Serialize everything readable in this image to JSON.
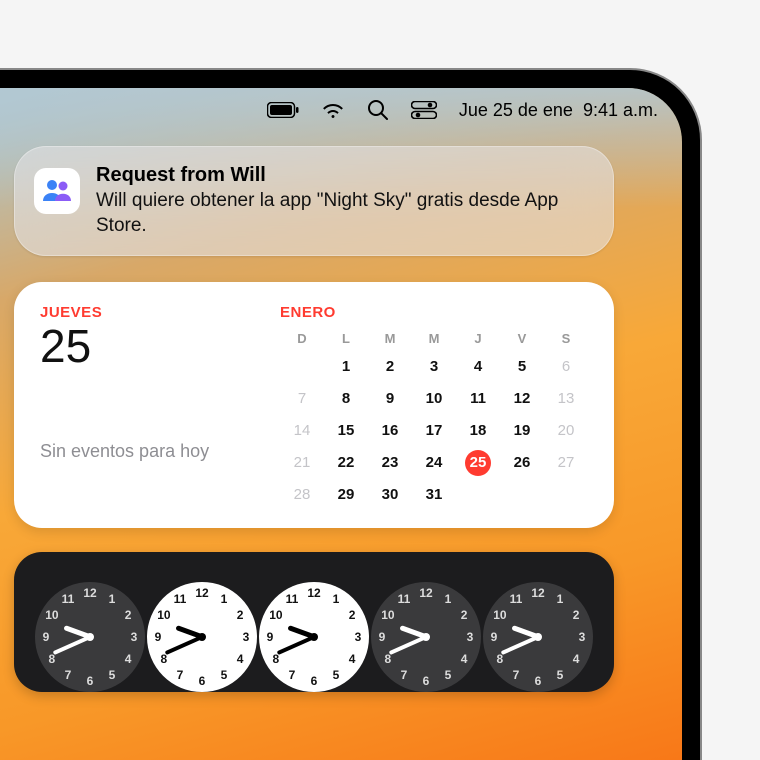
{
  "statusbar": {
    "date": "Jue 25 de ene",
    "time": "9:41 a.m."
  },
  "notification": {
    "title": "Request from Will",
    "body": "Will quiere obtener la app \"Night Sky\" gratis desde App Store.",
    "icon": "family-people-icon"
  },
  "calendar": {
    "dow": "JUEVES",
    "daynum": "25",
    "noevents": "Sin eventos para hoy",
    "month": "ENERO",
    "weekdays": [
      "D",
      "L",
      "M",
      "M",
      "J",
      "V",
      "S"
    ],
    "weeks": [
      [
        {
          "n": "",
          "dim": true
        },
        {
          "n": "1"
        },
        {
          "n": "2"
        },
        {
          "n": "3"
        },
        {
          "n": "4"
        },
        {
          "n": "5"
        },
        {
          "n": "6",
          "dim": true
        }
      ],
      [
        {
          "n": "7",
          "dim": true
        },
        {
          "n": "8"
        },
        {
          "n": "9"
        },
        {
          "n": "10"
        },
        {
          "n": "11"
        },
        {
          "n": "12"
        },
        {
          "n": "13",
          "dim": true
        }
      ],
      [
        {
          "n": "14",
          "dim": true
        },
        {
          "n": "15"
        },
        {
          "n": "16"
        },
        {
          "n": "17"
        },
        {
          "n": "18"
        },
        {
          "n": "19"
        },
        {
          "n": "20",
          "dim": true
        }
      ],
      [
        {
          "n": "21",
          "dim": true
        },
        {
          "n": "22"
        },
        {
          "n": "23"
        },
        {
          "n": "24"
        },
        {
          "n": "25",
          "today": true
        },
        {
          "n": "26"
        },
        {
          "n": "27",
          "dim": true
        }
      ],
      [
        {
          "n": "28",
          "dim": true
        },
        {
          "n": "29"
        },
        {
          "n": "30"
        },
        {
          "n": "31"
        },
        {
          "n": ""
        },
        {
          "n": ""
        },
        {
          "n": ""
        }
      ]
    ]
  },
  "clocks": {
    "face_numbers": [
      "12",
      "1",
      "2",
      "3",
      "4",
      "5",
      "6",
      "7",
      "8",
      "9",
      "10",
      "11"
    ],
    "items": [
      {
        "theme": "dark"
      },
      {
        "theme": "light"
      },
      {
        "theme": "light"
      },
      {
        "theme": "dark"
      },
      {
        "theme": "dark"
      }
    ]
  }
}
